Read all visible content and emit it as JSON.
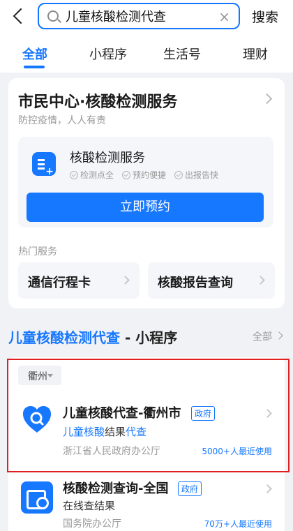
{
  "search": {
    "query": "儿童核酸检测代查",
    "action_label": "搜索"
  },
  "tabs": [
    {
      "label": "全部"
    },
    {
      "label": "小程序"
    },
    {
      "label": "生活号"
    },
    {
      "label": "理财"
    }
  ],
  "service_card": {
    "title": "市民中心·核酸检测服务",
    "subtitle": "防控疫情，人人有责",
    "service_title": "核酸检测服务",
    "tags": [
      "检测点全",
      "预约便捷",
      "出报告快"
    ],
    "book_button": "立即预约",
    "hot_label": "热门服务",
    "hot_items": [
      "通信行程卡",
      "核酸报告查询"
    ]
  },
  "section": {
    "title_highlight": "儿童核酸检测代查",
    "title_suffix": " - 小程序",
    "all_label": "全部"
  },
  "filter": {
    "city": "衢州"
  },
  "results": [
    {
      "title": "儿童核酸代查-衢州市",
      "badge": "政府",
      "desc_parts": [
        "儿童核酸",
        "结果",
        "代查"
      ],
      "org": "浙江省人民政府办公厅",
      "users": "5000+人最近使用"
    },
    {
      "title": "核酸检测查询-全国",
      "badge": "政府",
      "desc": "在线查结果",
      "org": "国务院办公厅",
      "users": "70万+人最近使用"
    }
  ],
  "colors": {
    "accent": "#1677ff",
    "highlight_box": "#e02020"
  }
}
